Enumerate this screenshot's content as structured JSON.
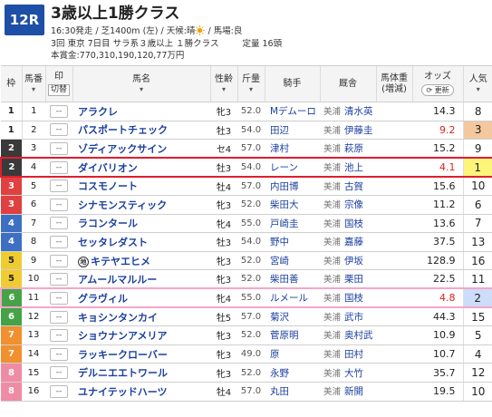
{
  "race": {
    "number": "12R",
    "name": "3歳以上1勝クラス",
    "info_line1": "16:30発走 / 芝1400m (左) / 天候:晴",
    "info_line1_end": " / 馬場:良",
    "weather_icon": "sun-icon",
    "info_line2": "3回 東京 7日目 サラ系３歳以上 １勝クラス",
    "capacity": "定量 16頭",
    "prize": "本賞金:770,310,190,120,77万円"
  },
  "columns": {
    "waku": "枠",
    "umaban": "馬番",
    "mark": "印",
    "mark_btn": "切替",
    "name": "馬名",
    "sexage": "性齢",
    "weight": "斤量",
    "jockey": "騎手",
    "stable": "厩舎",
    "body_weight": "馬体重",
    "body_weight_sub": "(増減)",
    "odds": "オッズ",
    "refresh": "更新",
    "popularity": "人気"
  },
  "colors": {
    "race_badge": "#1c4fa5",
    "highlight_red": "#e01e2e",
    "highlight_pink": "#f4a6c8",
    "odds_hot": "#e02020",
    "horse_link": "#1a3f9e"
  },
  "rows": [
    {
      "waku": "1",
      "umaban": "1",
      "mark": "--",
      "name": "アラクレ",
      "sexage": "牝3",
      "weight": "52.0",
      "jockey": "Mデムーロ",
      "region": "美浦",
      "stable": "清水英",
      "body_weight": "",
      "odds": "14.3",
      "pop": "8"
    },
    {
      "waku": "1",
      "umaban": "2",
      "mark": "--",
      "name": "パスポートチェック",
      "sexage": "牡3",
      "weight": "54.0",
      "jockey": "田辺",
      "region": "美浦",
      "stable": "伊藤圭",
      "body_weight": "",
      "odds": "9.2",
      "pop": "3"
    },
    {
      "waku": "2",
      "umaban": "3",
      "mark": "--",
      "name": "ゾディアックサイン",
      "sexage": "セ4",
      "weight": "57.0",
      "jockey": "津村",
      "region": "美浦",
      "stable": "萩原",
      "body_weight": "",
      "odds": "15.2",
      "pop": "9"
    },
    {
      "waku": "2",
      "umaban": "4",
      "mark": "--",
      "name": "ダイバリオン",
      "sexage": "牡3",
      "weight": "54.0",
      "jockey": "レーン",
      "region": "美浦",
      "stable": "池上",
      "body_weight": "",
      "odds": "4.1",
      "pop": "1"
    },
    {
      "waku": "3",
      "umaban": "5",
      "mark": "--",
      "name": "コスモノート",
      "sexage": "牡4",
      "weight": "57.0",
      "jockey": "内田博",
      "region": "美浦",
      "stable": "古賀",
      "body_weight": "",
      "odds": "15.6",
      "pop": "10"
    },
    {
      "waku": "3",
      "umaban": "6",
      "mark": "--",
      "name": "シナモンスティック",
      "sexage": "牝3",
      "weight": "52.0",
      "jockey": "柴田大",
      "region": "美浦",
      "stable": "宗像",
      "body_weight": "",
      "odds": "11.2",
      "pop": "6"
    },
    {
      "waku": "4",
      "umaban": "7",
      "mark": "--",
      "name": "ラコンタール",
      "sexage": "牝4",
      "weight": "55.0",
      "jockey": "戸崎圭",
      "region": "美浦",
      "stable": "国枝",
      "body_weight": "",
      "odds": "13.6",
      "pop": "7"
    },
    {
      "waku": "4",
      "umaban": "8",
      "mark": "--",
      "name": "セッタレダスト",
      "sexage": "牡3",
      "weight": "54.0",
      "jockey": "野中",
      "region": "美浦",
      "stable": "嘉藤",
      "body_weight": "",
      "odds": "37.5",
      "pop": "13"
    },
    {
      "waku": "5",
      "umaban": "9",
      "mark": "--",
      "name": "キテヤエヒメ",
      "name_prefix": "地",
      "sexage": "牝3",
      "weight": "52.0",
      "jockey": "宮崎",
      "region": "美浦",
      "stable": "伊坂",
      "body_weight": "",
      "odds": "128.9",
      "pop": "16"
    },
    {
      "waku": "5",
      "umaban": "10",
      "mark": "--",
      "name": "アムールマルルー",
      "sexage": "牝3",
      "weight": "52.0",
      "jockey": "柴田善",
      "region": "美浦",
      "stable": "栗田",
      "body_weight": "",
      "odds": "22.5",
      "pop": "11"
    },
    {
      "waku": "6",
      "umaban": "11",
      "mark": "--",
      "name": "グラヴィル",
      "sexage": "牝4",
      "weight": "55.0",
      "jockey": "ルメール",
      "region": "美浦",
      "stable": "国枝",
      "body_weight": "",
      "odds": "4.8",
      "pop": "2"
    },
    {
      "waku": "6",
      "umaban": "12",
      "mark": "--",
      "name": "キョシンタンカイ",
      "sexage": "牡5",
      "weight": "57.0",
      "jockey": "菊沢",
      "region": "美浦",
      "stable": "武市",
      "body_weight": "",
      "odds": "44.3",
      "pop": "15"
    },
    {
      "waku": "7",
      "umaban": "13",
      "mark": "--",
      "name": "ショウナンアメリア",
      "sexage": "牝3",
      "weight": "52.0",
      "jockey": "菅原明",
      "region": "美浦",
      "stable": "奥村武",
      "body_weight": "",
      "odds": "10.9",
      "pop": "5"
    },
    {
      "waku": "7",
      "umaban": "14",
      "mark": "--",
      "name": "ラッキークローバー",
      "sexage": "牝3",
      "weight": "49.0",
      "jockey": "原",
      "region": "美浦",
      "stable": "田村",
      "body_weight": "",
      "odds": "10.7",
      "pop": "4"
    },
    {
      "waku": "8",
      "umaban": "15",
      "mark": "--",
      "name": "デルニエエトワール",
      "sexage": "牝3",
      "weight": "52.0",
      "jockey": "永野",
      "region": "美浦",
      "stable": "大竹",
      "body_weight": "",
      "odds": "35.7",
      "pop": "12"
    },
    {
      "waku": "8",
      "umaban": "16",
      "mark": "--",
      "name": "ユナイテッドハーツ",
      "sexage": "牡4",
      "weight": "57.0",
      "jockey": "丸田",
      "region": "美浦",
      "stable": "新開",
      "body_weight": "",
      "odds": "19.5",
      "pop": "10"
    }
  ]
}
